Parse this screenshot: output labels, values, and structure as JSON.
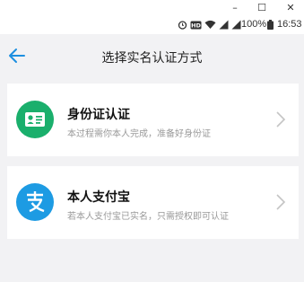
{
  "window": {
    "minimize": "–",
    "maximize": "☐",
    "close": "✕"
  },
  "status": {
    "icons": [
      "alarm-icon",
      "hd-icon",
      "wifi-icon",
      "signal-icon",
      "signal-icon",
      "battery-icon"
    ],
    "hd_label": "HD",
    "battery": "100%",
    "time": "16:53"
  },
  "header": {
    "title": "选择实名认证方式"
  },
  "options": [
    {
      "title": "身份证认证",
      "subtitle": "本过程需你本人完成，准备好身份证",
      "icon": "id-card-icon",
      "color": "#1aaf6c"
    },
    {
      "title": "本人支付宝",
      "subtitle": "若本人支付宝已实名，只需授权即可认证",
      "icon": "alipay-icon",
      "color": "#1d9be3"
    }
  ]
}
